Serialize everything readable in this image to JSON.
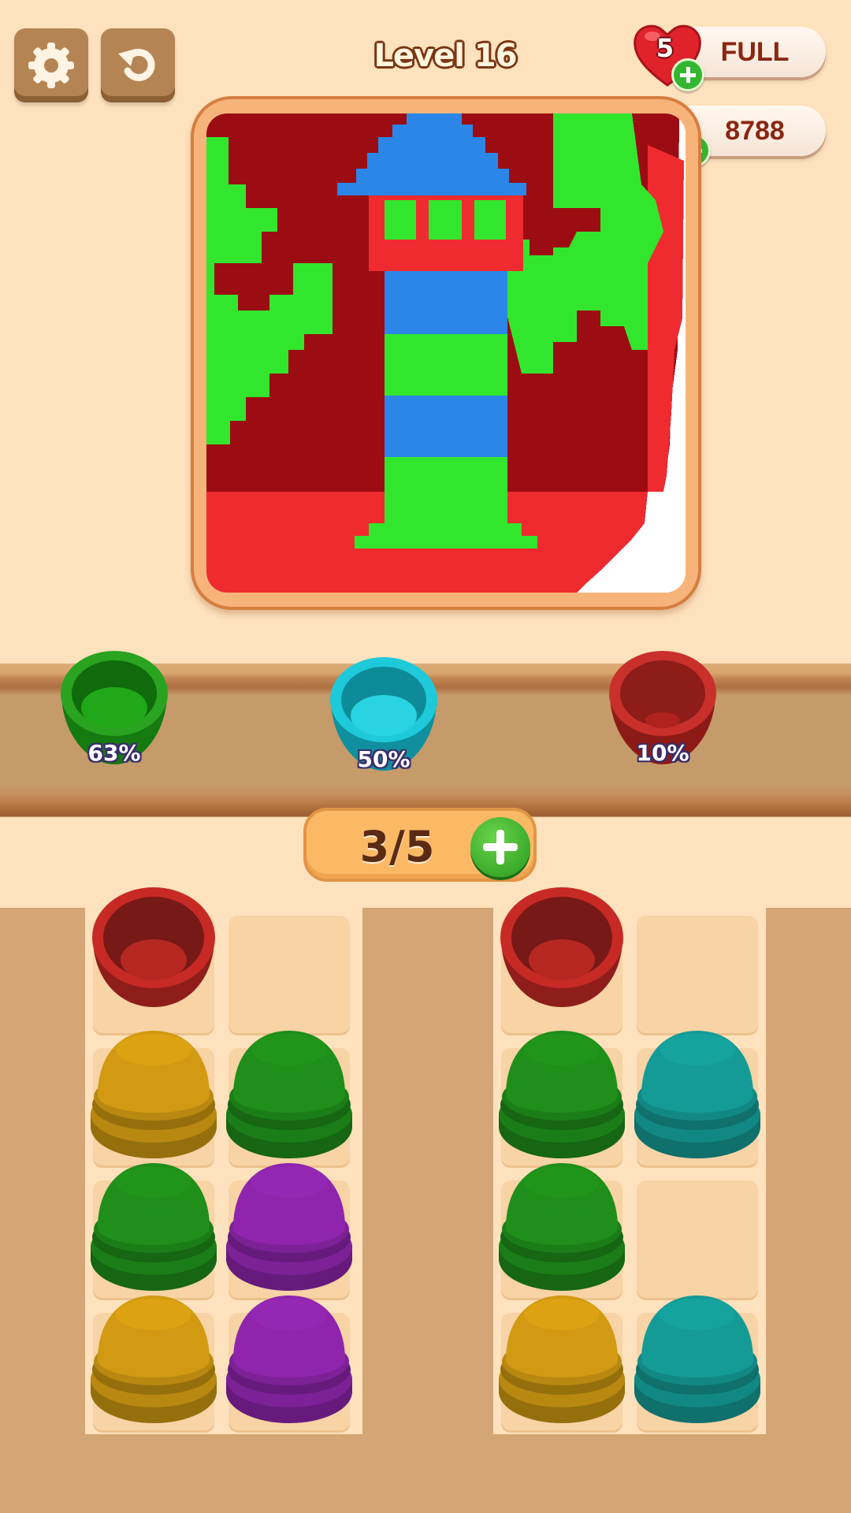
{
  "header": {
    "level_title": "Level 16",
    "lives_count": "5",
    "lives_status": "FULL",
    "coins": "8788"
  },
  "targets": [
    {
      "color": "#2aa320",
      "inner": "#1d8f16",
      "dark": "#157a10",
      "percent": "63%",
      "fill": 0.63
    },
    {
      "color": "#1ec9d9",
      "inner": "#16b2c2",
      "dark": "#10909e",
      "percent": "50%",
      "fill": 0.5
    },
    {
      "color": "#c9302b",
      "inner": "#a8241f",
      "dark": "#8c1a16",
      "percent": "10%",
      "fill": 0.1
    }
  ],
  "counter": {
    "text": "3/5"
  },
  "colors": {
    "red": "#c72a25",
    "green": "#1f8e1a",
    "yellow": "#d19a12",
    "purple": "#8e25ac",
    "teal": "#159b96",
    "cyan": "#1ec9d9",
    "picture_dark_red": "#9b0d12",
    "picture_red": "#ef2b2f",
    "picture_green": "#32e62d",
    "picture_blue": "#2b86e8"
  },
  "columns": [
    {
      "slots": [
        "red-open",
        "yellow",
        "green",
        "yellow"
      ]
    },
    {
      "slots": [
        "empty",
        "green",
        "purple",
        "purple"
      ]
    },
    {
      "slots": [
        "red-open",
        "green",
        "green",
        "yellow"
      ]
    },
    {
      "slots": [
        "empty",
        "teal",
        "empty",
        "teal"
      ]
    }
  ]
}
